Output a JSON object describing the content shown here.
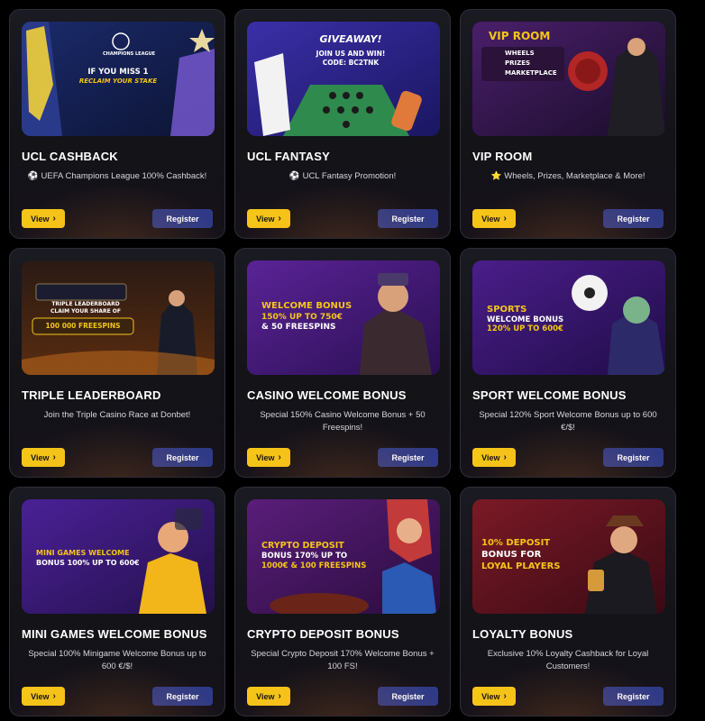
{
  "buttons": {
    "view": "View",
    "register": "Register"
  },
  "colors": {
    "view_button": "#f5c518",
    "register_button": "#2f3a86",
    "card_bg": "#16161c"
  },
  "cards": [
    {
      "title": "UCL CASHBACK",
      "desc_icon": "⚽",
      "description": "UEFA Champions League 100% Cashback!",
      "banner": {
        "top_label": "CHAMPIONS LEAGUE",
        "line1": "IF YOU MISS 1",
        "line2": "RECLAIM YOUR STAKE"
      }
    },
    {
      "title": "UCL FANTASY",
      "desc_icon": "⚽",
      "description": "UCL Fantasy Promotion!",
      "banner": {
        "line1": "GIVEAWAY!",
        "line2": "JOIN US AND WIN!",
        "line3": "CODE: BC2TNK"
      }
    },
    {
      "title": "VIP ROOM",
      "desc_icon": "⭐",
      "description": "Wheels, Prizes, Marketplace & More!",
      "banner": {
        "line1": "VIP ROOM",
        "items": [
          "WHEELS",
          "PRIZES",
          "MARKETPLACE"
        ]
      }
    },
    {
      "title": "TRIPLE LEADERBOARD",
      "desc_icon": "",
      "description": "Join the Triple Casino Race at Donbet!",
      "banner": {
        "line1": "TRIPLE LEADERBOARD",
        "line2": "CLAIM YOUR SHARE OF",
        "line3": "100 000 FREESPINS"
      }
    },
    {
      "title": "CASINO WELCOME BONUS",
      "desc_icon": "",
      "description": "Special 150% Casino Welcome Bonus + 50 Freespins!",
      "banner": {
        "line1": "WELCOME BONUS",
        "line2": "150% UP TO 750€",
        "line3": "& 50 FREESPINS"
      }
    },
    {
      "title": "SPORT WELCOME BONUS",
      "desc_icon": "",
      "description": "Special 120% Sport Welcome Bonus up to 600 €/$!",
      "banner": {
        "line1": "SPORTS",
        "line2": "WELCOME BONUS",
        "line3": "120% UP TO 600€"
      }
    },
    {
      "title": "MINI GAMES WELCOME BONUS",
      "desc_icon": "",
      "description": "Special 100% Minigame Welcome Bonus up to 600 €/$!",
      "banner": {
        "line1": "MINI GAMES WELCOME",
        "line2": "BONUS 100% UP TO 600€"
      }
    },
    {
      "title": "CRYPTO DEPOSIT BONUS",
      "desc_icon": "",
      "description": "Special Crypto Deposit 170% Welcome Bonus + 100 FS!",
      "banner": {
        "line1": "CRYPTO DEPOSIT",
        "line2": "BONUS 170% UP TO",
        "line3": "1000€ & 100 FREESPINS"
      }
    },
    {
      "title": "LOYALTY BONUS",
      "desc_icon": "",
      "description": "Exclusive 10% Loyalty Cashback for Loyal Customers!",
      "banner": {
        "line1": "10% DEPOSIT",
        "line2": "BONUS FOR",
        "line3": "LOYAL PLAYERS"
      }
    }
  ]
}
